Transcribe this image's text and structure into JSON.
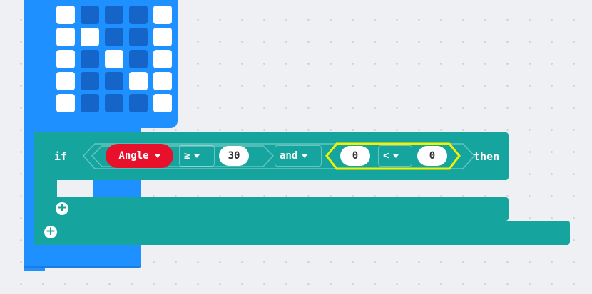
{
  "blocks": {
    "if_keyword": "if",
    "then_keyword": "then",
    "and_label": "and",
    "variable": "Angle",
    "comparison_op": "≥",
    "comparison_value": "30",
    "inner_left_value": "0",
    "inner_op": "<",
    "inner_right_value": "0",
    "plus_symbol": "+"
  },
  "led_matrix": [
    [
      1,
      0,
      0,
      0,
      1
    ],
    [
      1,
      1,
      0,
      0,
      1
    ],
    [
      1,
      0,
      1,
      0,
      1
    ],
    [
      1,
      0,
      0,
      1,
      1
    ],
    [
      1,
      0,
      0,
      0,
      1
    ]
  ],
  "colors": {
    "workspace": "#eef0f3",
    "basic_block": "#1e90ff",
    "logic_block": "#16a59e",
    "variable_block": "#e8112b",
    "selection_highlight": "#f2f200"
  }
}
